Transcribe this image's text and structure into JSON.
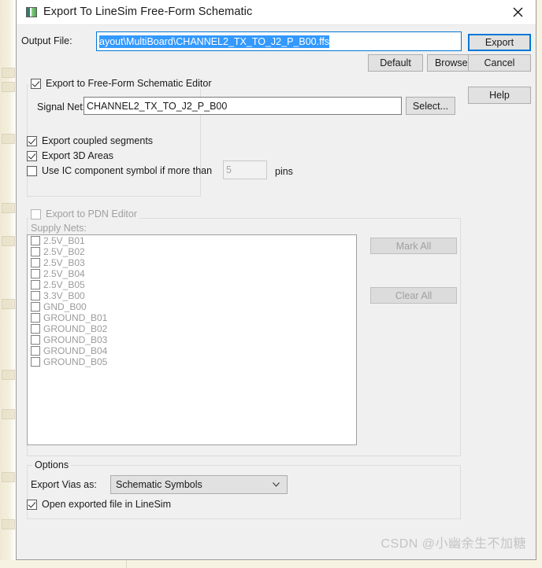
{
  "window": {
    "title": "Export To LineSim Free-Form Schematic",
    "icon": "app-icon",
    "close_icon": "close-icon"
  },
  "output": {
    "label": "Output File:",
    "value": "ayout\\MultiBoard\\CHANNEL2_TX_TO_J2_P_B00.ffs",
    "selected": true,
    "default_label": "Default",
    "browse_label": "Browse..."
  },
  "actions": {
    "export_label": "Export",
    "cancel_label": "Cancel",
    "help_label": "Help"
  },
  "schematic_group": {
    "title": "Export to Free-Form Schematic Editor",
    "checked": true,
    "signal_net_label": "Signal Net:",
    "signal_net_value": "CHANNEL2_TX_TO_J2_P_B00",
    "select_label": "Select...",
    "options": [
      {
        "label": "Export coupled segments",
        "checked": true,
        "disabled": false
      },
      {
        "label": "Export 3D Areas",
        "checked": true,
        "disabled": false
      },
      {
        "label": "Use IC component symbol if more than",
        "checked": false,
        "disabled": false
      }
    ],
    "pins_value": "5",
    "pins_label": "pins",
    "pins_disabled": true
  },
  "pdn_group": {
    "title": "Export to PDN Editor",
    "checked": false,
    "disabled": true,
    "supply_nets_label": "Supply Nets:",
    "supply_nets": [
      "2.5V_B01",
      "2.5V_B02",
      "2.5V_B03",
      "2.5V_B04",
      "2.5V_B05",
      "3.3V_B00",
      "GND_B00",
      "GROUND_B01",
      "GROUND_B02",
      "GROUND_B03",
      "GROUND_B04",
      "GROUND_B05"
    ],
    "mark_all_label": "Mark All",
    "clear_all_label": "Clear All",
    "buttons_disabled": true
  },
  "options_group": {
    "title": "Options",
    "vias_label": "Export Vias as:",
    "vias_value": "Schematic Symbols",
    "vias_options": [
      "Schematic Symbols"
    ],
    "open_in_linesim_label": "Open exported file in LineSim",
    "open_in_linesim_checked": true
  },
  "watermark": {
    "text": "CSDN @小幽余生不加糖"
  },
  "colors": {
    "accent": "#0078d7",
    "selection": "#3399ff",
    "dialog_bg": "#f0f0f0",
    "disabled_text": "#a0a0a0"
  }
}
